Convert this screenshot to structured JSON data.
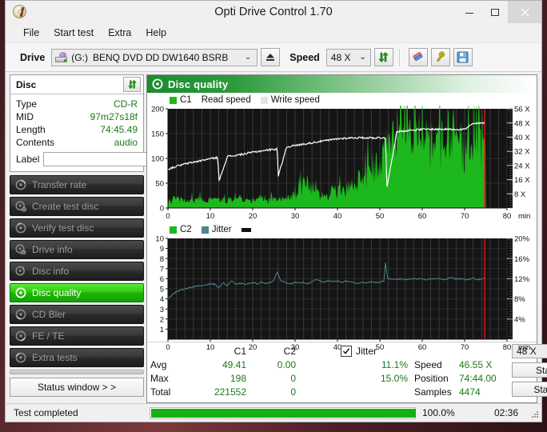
{
  "window": {
    "title": "Opti Drive Control 1.70",
    "app_icon": "disc-icon",
    "minimize": "–",
    "maximize": "□",
    "close": "✕"
  },
  "menu": {
    "items": [
      {
        "label": "File"
      },
      {
        "label": "Start test"
      },
      {
        "label": "Extra"
      },
      {
        "label": "Help"
      }
    ]
  },
  "toolbar": {
    "drive_label": "Drive",
    "drive_letter": "(G:)",
    "drive_name": "BENQ DVD DD DW1640 BSRB",
    "eject_icon": "eject-icon",
    "speed_label": "Speed",
    "speed_value": "48 X",
    "refresh_icon": "refresh-arrows-icon",
    "eraser_icon": "eraser-icon",
    "wrench_icon": "wrench-icon",
    "save_icon": "floppy-save-icon"
  },
  "disc_panel": {
    "title": "Disc",
    "refresh_icon": "refresh-arrows-icon",
    "rows": [
      {
        "key": "Type",
        "value": "CD-R"
      },
      {
        "key": "MID",
        "value": "97m27s18f"
      },
      {
        "key": "Length",
        "value": "74:45.49"
      },
      {
        "key": "Contents",
        "value": "audio"
      }
    ],
    "label_key": "Label",
    "label_value": "",
    "label_placeholder": "",
    "label_button_icon": "cd-icon"
  },
  "nav": {
    "items": [
      {
        "label": "Transfer rate",
        "icon": "disc-test-icon",
        "active": false
      },
      {
        "label": "Create test disc",
        "icon": "disc-burn-icon",
        "active": false
      },
      {
        "label": "Verify test disc",
        "icon": "disc-check-icon",
        "active": false
      },
      {
        "label": "Drive info",
        "icon": "drive-info-icon",
        "active": false
      },
      {
        "label": "Disc info",
        "icon": "disc-info-icon",
        "active": false
      },
      {
        "label": "Disc quality",
        "icon": "disc-quality-icon",
        "active": true
      },
      {
        "label": "CD Bler",
        "icon": "disc-bler-icon",
        "active": false
      },
      {
        "label": "FE / TE",
        "icon": "disc-fete-icon",
        "active": false
      },
      {
        "label": "Extra tests",
        "icon": "disc-extra-icon",
        "active": false
      }
    ],
    "status_window_label": "Status window > >"
  },
  "panel": {
    "header_title": "Disc quality",
    "header_icon": "disc-quality-icon"
  },
  "chart_data": [
    {
      "type": "area",
      "name": "c1-read-write-chart",
      "title": "",
      "xlabel": "min",
      "ylabel": "",
      "xlim": [
        0,
        80
      ],
      "ylim": [
        0,
        200
      ],
      "xticks": [
        0,
        10,
        20,
        30,
        40,
        50,
        60,
        70,
        80
      ],
      "yticks": [
        0,
        50,
        100,
        150,
        200
      ],
      "y2ticks": [
        "8 X",
        "16 X",
        "24 X",
        "32 X",
        "40 X",
        "48 X",
        "56 X"
      ],
      "y2lim": [
        0,
        56
      ],
      "grid": true,
      "legend": [
        {
          "label": "C1",
          "color": "#1db81d"
        },
        {
          "label": "Read speed",
          "color": "#ffffff"
        },
        {
          "label": "Write speed",
          "color": "#e8e8e8"
        }
      ],
      "marker_position_min": 74.73,
      "marker_color": "#ee1111",
      "series": [
        {
          "name": "C1",
          "color": "#1db81d",
          "kind": "area",
          "x": [
            0,
            1,
            2,
            3,
            4,
            5,
            6,
            7,
            8,
            9,
            10,
            11,
            12,
            13,
            14,
            15,
            16,
            17,
            18,
            19,
            20,
            21,
            22,
            23,
            24,
            25,
            26,
            27,
            28,
            29,
            30,
            31,
            32,
            33,
            34,
            35,
            36,
            37,
            38,
            39,
            40,
            41,
            42,
            43,
            44,
            45,
            46,
            47,
            48,
            49,
            50,
            51,
            52,
            53,
            54,
            55,
            56,
            57,
            58,
            59,
            60,
            61,
            62,
            63,
            64,
            65,
            66,
            67,
            68,
            69,
            70,
            71,
            72,
            73,
            74,
            75
          ],
          "values": [
            14,
            22,
            30,
            18,
            26,
            16,
            24,
            20,
            28,
            18,
            22,
            30,
            20,
            26,
            16,
            24,
            22,
            28,
            18,
            26,
            20,
            24,
            30,
            18,
            22,
            26,
            20,
            28,
            24,
            30,
            34,
            52,
            76,
            44,
            38,
            46,
            34,
            42,
            38,
            52,
            44,
            60,
            38,
            68,
            52,
            86,
            74,
            108,
            96,
            126,
            118,
            150,
            168,
            176,
            160,
            188,
            174,
            192,
            178,
            196,
            184,
            190,
            176,
            198,
            186,
            192,
            180,
            194,
            172,
            188,
            176,
            182,
            168,
            190,
            176,
            166
          ]
        },
        {
          "name": "Read speed",
          "color": "#ffffff",
          "kind": "line",
          "axis": "right",
          "x": [
            0,
            2,
            4,
            6,
            8,
            10,
            11.8,
            12.0,
            14,
            16,
            18,
            20,
            22,
            24,
            25.8,
            26.0,
            28,
            30,
            32,
            34,
            36,
            38,
            40,
            42,
            44,
            46,
            48,
            50,
            51.4,
            51.6,
            54,
            56,
            58,
            60,
            62,
            64,
            66,
            68,
            70,
            72,
            74,
            75
          ],
          "values": [
            21.8,
            23.5,
            24.8,
            25.8,
            26.8,
            27.8,
            28.5,
            14.8,
            29.0,
            29.6,
            30.5,
            31.4,
            32.2,
            32.8,
            33.4,
            17.8,
            34.5,
            35.2,
            36.0,
            36.8,
            37.6,
            38.2,
            39.0,
            39.4,
            39.6,
            39.6,
            39.6,
            39.6,
            39.6,
            10.5,
            43.0,
            43.6,
            44.0,
            44.3,
            44.4,
            44.4,
            44.4,
            44.4,
            44.4,
            47.5,
            47.8,
            47.8
          ]
        }
      ]
    },
    {
      "type": "line",
      "name": "c2-jitter-chart",
      "title": "",
      "xlabel": "min",
      "ylabel": "",
      "xlim": [
        0,
        80
      ],
      "ylim": [
        0,
        10
      ],
      "xticks": [
        0,
        10,
        20,
        30,
        40,
        50,
        60,
        70,
        80
      ],
      "yticks": [
        1,
        2,
        3,
        4,
        5,
        6,
        7,
        8,
        9,
        10
      ],
      "y2ticks": [
        "4%",
        "8%",
        "12%",
        "16%",
        "20%"
      ],
      "y2lim": [
        0,
        20
      ],
      "grid": true,
      "legend": [
        {
          "label": "C2",
          "color": "#1db81d"
        },
        {
          "label": "Jitter",
          "color": "#4c8691"
        }
      ],
      "marker_position_min": 74.73,
      "marker_color": "#ee1111",
      "series": [
        {
          "name": "C2",
          "color": "#1db81d",
          "kind": "area",
          "x": [
            0,
            75
          ],
          "values": [
            0,
            0
          ]
        },
        {
          "name": "Jitter",
          "color": "#4c8691",
          "kind": "line",
          "axis": "right",
          "x": [
            0,
            1,
            2,
            3,
            4,
            5,
            6,
            7,
            8,
            9,
            10,
            11,
            12,
            13,
            14,
            15,
            16,
            17,
            18,
            19,
            20,
            21,
            22,
            23,
            24,
            25,
            25.8,
            26.6,
            28,
            29,
            30,
            31,
            32,
            33,
            34,
            35,
            36,
            37,
            38,
            39,
            40,
            41,
            42,
            43,
            44,
            45,
            46,
            47,
            48,
            49,
            50,
            51,
            51.3,
            51.8,
            53,
            54,
            55,
            56,
            57,
            58,
            59,
            60,
            61,
            62,
            63,
            64,
            65,
            66,
            67,
            68,
            69,
            70,
            71,
            72,
            73,
            74,
            75
          ],
          "values": [
            8.0,
            8.8,
            9.4,
            9.7,
            10.0,
            10.2,
            10.4,
            10.5,
            10.6,
            10.8,
            11.0,
            10.9,
            10.2,
            11.2,
            10.6,
            11.6,
            10.8,
            11.1,
            10.9,
            11.0,
            11.2,
            11.0,
            11.3,
            11.1,
            11.2,
            11.6,
            13.4,
            11.6,
            11.2,
            11.0,
            11.2,
            11.1,
            11.3,
            11.0,
            11.4,
            11.8,
            11.5,
            11.3,
            11.6,
            11.4,
            11.5,
            11.3,
            11.5,
            11.4,
            11.2,
            11.0,
            11.3,
            11.2,
            11.4,
            11.2,
            11.3,
            11.6,
            15.4,
            12.0,
            11.8,
            11.9,
            12.0,
            11.8,
            11.9,
            12.1,
            11.9,
            12.0,
            11.8,
            12.0,
            11.9,
            12.1,
            11.8,
            12.0,
            12.2,
            11.9,
            12.0,
            11.8,
            11.9,
            12.1,
            11.8,
            11.9,
            12.0
          ]
        }
      ]
    }
  ],
  "stats": {
    "col_headers": [
      "C1",
      "C2"
    ],
    "jitter_label": "Jitter",
    "jitter_checked": true,
    "rows": [
      {
        "label": "Avg",
        "c1": "49.41",
        "c2": "0.00",
        "jitter": "11.1%"
      },
      {
        "label": "Max",
        "c1": "198",
        "c2": "0",
        "jitter": "15.0%"
      },
      {
        "label": "Total",
        "c1": "221552",
        "c2": "0",
        "jitter": ""
      }
    ],
    "info": [
      {
        "label": "Speed",
        "value": "46.55 X"
      },
      {
        "label": "Position",
        "value": "74:44.00"
      },
      {
        "label": "Samples",
        "value": "4474"
      }
    ],
    "speed_value": "48 X",
    "start_full_label": "Start full",
    "start_part_label": "Start part"
  },
  "statusbar": {
    "text": "Test completed",
    "percent_label": "100.0%",
    "progress": 100,
    "time": "02:36"
  },
  "colors": {
    "accent_green": "#14b114",
    "c1_green": "#1db81d",
    "jitter_teal": "#4c8691",
    "marker_red": "#ee1111",
    "value_text": "#1a7a1a",
    "chart_bg": "#1a1a1a"
  }
}
